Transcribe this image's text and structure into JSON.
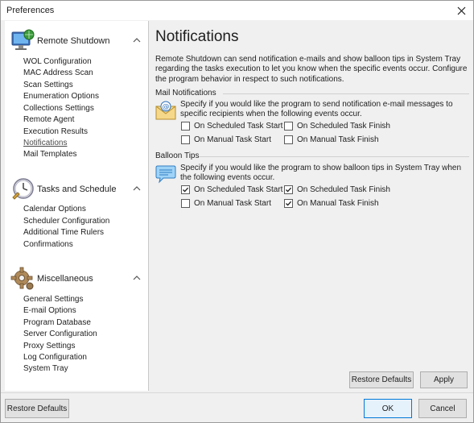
{
  "window": {
    "title": "Preferences"
  },
  "sidebar": {
    "sections": [
      {
        "label": "Remote Shutdown",
        "icon": "monitor-globe-icon",
        "items": [
          {
            "label": "WOL Configuration"
          },
          {
            "label": "MAC Address Scan"
          },
          {
            "label": "Scan Settings"
          },
          {
            "label": "Enumeration Options"
          },
          {
            "label": "Collections Settings"
          },
          {
            "label": "Remote Agent"
          },
          {
            "label": "Execution Results"
          },
          {
            "label": "Notifications",
            "active": true
          },
          {
            "label": "Mail Templates"
          }
        ]
      },
      {
        "label": "Tasks and Schedule",
        "icon": "clock-icon",
        "items": [
          {
            "label": "Calendar Options"
          },
          {
            "label": "Scheduler Configuration"
          },
          {
            "label": "Additional Time Rulers"
          },
          {
            "label": "Confirmations"
          }
        ]
      },
      {
        "label": "Miscellaneous",
        "icon": "gear-icon",
        "items": [
          {
            "label": "General Settings"
          },
          {
            "label": "E-mail Options"
          },
          {
            "label": "Program Database"
          },
          {
            "label": "Server Configuration"
          },
          {
            "label": "Proxy Settings"
          },
          {
            "label": "Log Configuration"
          },
          {
            "label": "System Tray"
          }
        ]
      }
    ]
  },
  "main": {
    "title": "Notifications",
    "description": "Remote Shutdown can send notification e-mails and show balloon tips in System Tray regarding the tasks execution to let you know when the specific events occur. Configure the program behavior in respect to such notifications.",
    "mail": {
      "group_label": "Mail Notifications",
      "icon": "mail-at-icon",
      "text": "Specify if you would like the program to send notification e-mail messages to specific recipients when the following events occur.",
      "options": [
        {
          "label": "On Scheduled Task Start",
          "checked": false
        },
        {
          "label": "On Scheduled Task Finish",
          "checked": false
        },
        {
          "label": "On Manual Task Start",
          "checked": false
        },
        {
          "label": "On Manual Task Finish",
          "checked": false
        }
      ]
    },
    "balloon": {
      "group_label": "Balloon Tips",
      "icon": "speech-bubble-icon",
      "text": "Specify if you would like the program to show balloon tips in System Tray when the following events occur.",
      "options": [
        {
          "label": "On Scheduled Task Start",
          "checked": true
        },
        {
          "label": "On Scheduled Task Finish",
          "checked": true
        },
        {
          "label": "On Manual Task Start",
          "checked": false
        },
        {
          "label": "On Manual Task Finish",
          "checked": true
        }
      ]
    },
    "restore_defaults": "Restore Defaults",
    "apply": "Apply"
  },
  "footer": {
    "restore_defaults": "Restore Defaults",
    "ok": "OK",
    "cancel": "Cancel"
  },
  "colors": {
    "accent": "#0078d7",
    "sidebar_bg": "#ffffff",
    "panel_bg": "#f0f0f0"
  }
}
